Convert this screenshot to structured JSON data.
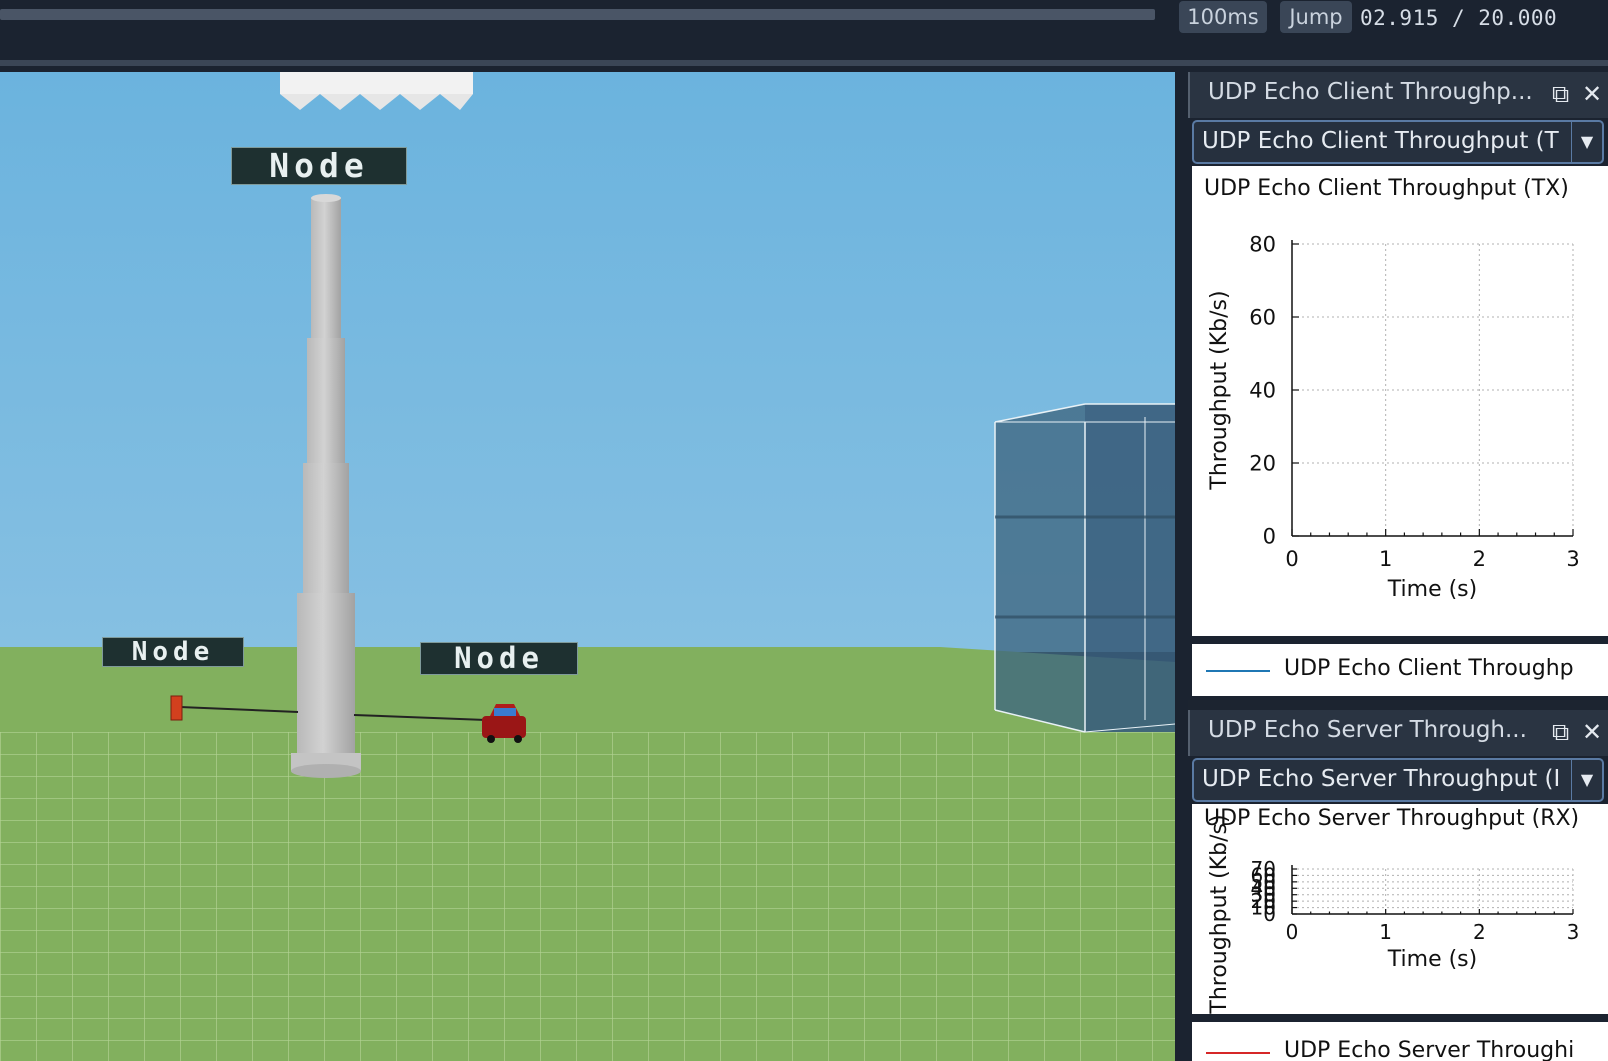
{
  "toolbar": {
    "step_button": "100ms",
    "jump_button": "Jump",
    "time_readout": "02.915 / 20.000"
  },
  "viewport": {
    "node_labels": [
      "Node",
      "Node",
      "Node"
    ]
  },
  "panels": [
    {
      "title": "UDP Echo Client Throughp...",
      "combo_value": "UDP Echo Client Throughput (T",
      "plot_title": "UDP Echo Client Throughput (TX)",
      "legend_label": "UDP Echo Client Throughp",
      "legend_color": "#1f77b4"
    },
    {
      "title": "UDP Echo Server Through...",
      "combo_value": "UDP Echo Server Throughput (I",
      "plot_title": "UDP Echo Server Throughput (RX)",
      "legend_label": "UDP Echo Server Throughi",
      "legend_color": "#d62728"
    }
  ],
  "chart_data": [
    {
      "type": "line",
      "title": "UDP Echo Client Throughput (TX)",
      "xlabel": "Time (s)",
      "ylabel": "Throughput (Kb/s)",
      "xlim": [
        0,
        3
      ],
      "ylim": [
        0,
        80
      ],
      "x_ticks": [
        "0",
        "1",
        "2",
        "3"
      ],
      "y_ticks": [
        "0",
        "20",
        "40",
        "60",
        "80"
      ],
      "grid": true,
      "series": [
        {
          "name": "UDP Echo Client Throughp",
          "color": "#1f77b4",
          "x": [],
          "y": []
        }
      ]
    },
    {
      "type": "line",
      "title": "UDP Echo Server Throughput (RX)",
      "xlabel": "Time (s)",
      "ylabel": "Throughput (Kb/s)",
      "xlim": [
        0,
        3
      ],
      "ylim": [
        0,
        70
      ],
      "x_ticks": [
        "0",
        "1",
        "2",
        "3"
      ],
      "y_ticks": [
        "0",
        "10",
        "20",
        "30",
        "40",
        "50",
        "60",
        "70"
      ],
      "grid": true,
      "series": [
        {
          "name": "UDP Echo Server Throughi",
          "color": "#d62728",
          "x": [],
          "y": []
        }
      ]
    }
  ]
}
